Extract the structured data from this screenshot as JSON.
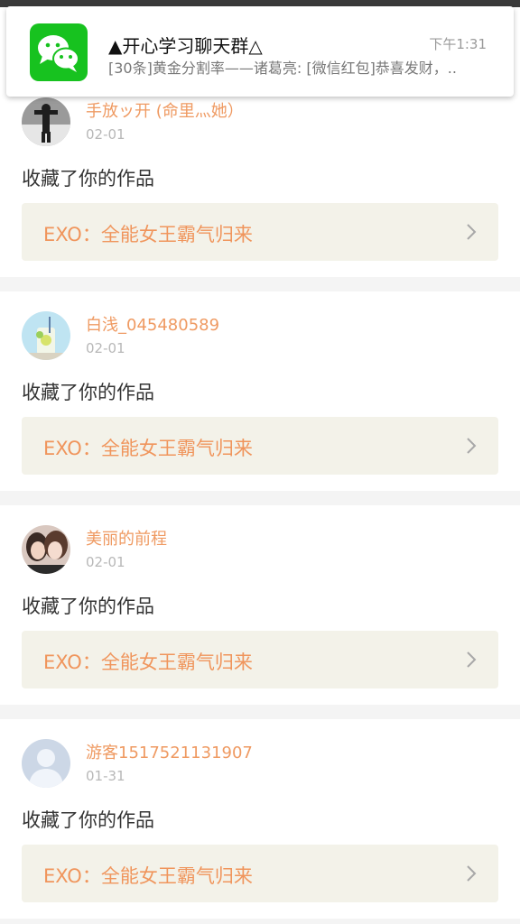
{
  "notification": {
    "title": "▲开心学习聊天群△",
    "time": "下午1:31",
    "body": "[30条]黄金分割率——诸葛亮: [微信红包]恭喜发财，..",
    "app_icon": "wechat-icon"
  },
  "feed": [
    {
      "user": "手放ッ开 (命里灬她）",
      "date": "02-01",
      "action": "收藏了你的作品",
      "work": "EXO：全能女王霸气归来",
      "avatar": "avatar-photo-person"
    },
    {
      "user": "白浅_045480589",
      "date": "02-01",
      "action": "收藏了你的作品",
      "work": "EXO：全能女王霸气归来",
      "avatar": "avatar-photo-drink"
    },
    {
      "user": "美丽的前程",
      "date": "02-01",
      "action": "收藏了你的作品",
      "work": "EXO：全能女王霸气归来",
      "avatar": "avatar-photo-couple"
    },
    {
      "user": "游客1517521131907",
      "date": "01-31",
      "action": "收藏了你的作品",
      "work": "EXO：全能女王霸气归来",
      "avatar": "avatar-default-silhouette"
    }
  ],
  "colors": {
    "username": "#ef9a62",
    "work_title": "#f0955c",
    "work_bg": "#f3f2e9",
    "wechat_green": "#17c21f"
  }
}
